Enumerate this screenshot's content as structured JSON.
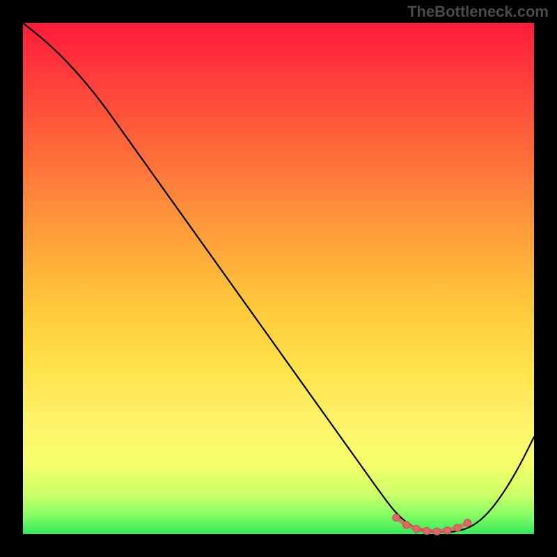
{
  "watermark": "TheBottleneck.com",
  "colors": {
    "curve_stroke": "#000000",
    "marker_fill": "#d96a66",
    "marker_stroke": "#c15652"
  },
  "chart_data": {
    "type": "line",
    "title": "",
    "xlabel": "",
    "ylabel": "",
    "xlim": [
      0,
      100
    ],
    "ylim": [
      0,
      100
    ],
    "series": [
      {
        "name": "bottleneck_curve",
        "x": [
          0,
          5,
          10,
          15,
          20,
          25,
          30,
          35,
          40,
          45,
          50,
          55,
          60,
          65,
          70,
          73,
          76,
          79,
          82,
          85,
          88,
          91,
          94,
          97,
          100
        ],
        "y": [
          100,
          96,
          91,
          85,
          78,
          71,
          64,
          57,
          50,
          43,
          36,
          29,
          22,
          15,
          8,
          4,
          1.5,
          0.5,
          0.3,
          0.5,
          1.5,
          4,
          8,
          13,
          19
        ]
      }
    ],
    "markers": {
      "name": "optimal_zone",
      "x": [
        73,
        75,
        77,
        79,
        81,
        83,
        85,
        87
      ],
      "y": [
        3.2,
        1.8,
        1.0,
        0.6,
        0.5,
        0.7,
        1.2,
        2.2
      ]
    },
    "gradient_stops": [
      {
        "pos": 0,
        "color": "#ff1a3a"
      },
      {
        "pos": 25,
        "color": "#ff6a3a"
      },
      {
        "pos": 55,
        "color": "#ffc83a"
      },
      {
        "pos": 78,
        "color": "#fff26a"
      },
      {
        "pos": 96,
        "color": "#8cff66"
      },
      {
        "pos": 100,
        "color": "#36e85b"
      }
    ]
  }
}
